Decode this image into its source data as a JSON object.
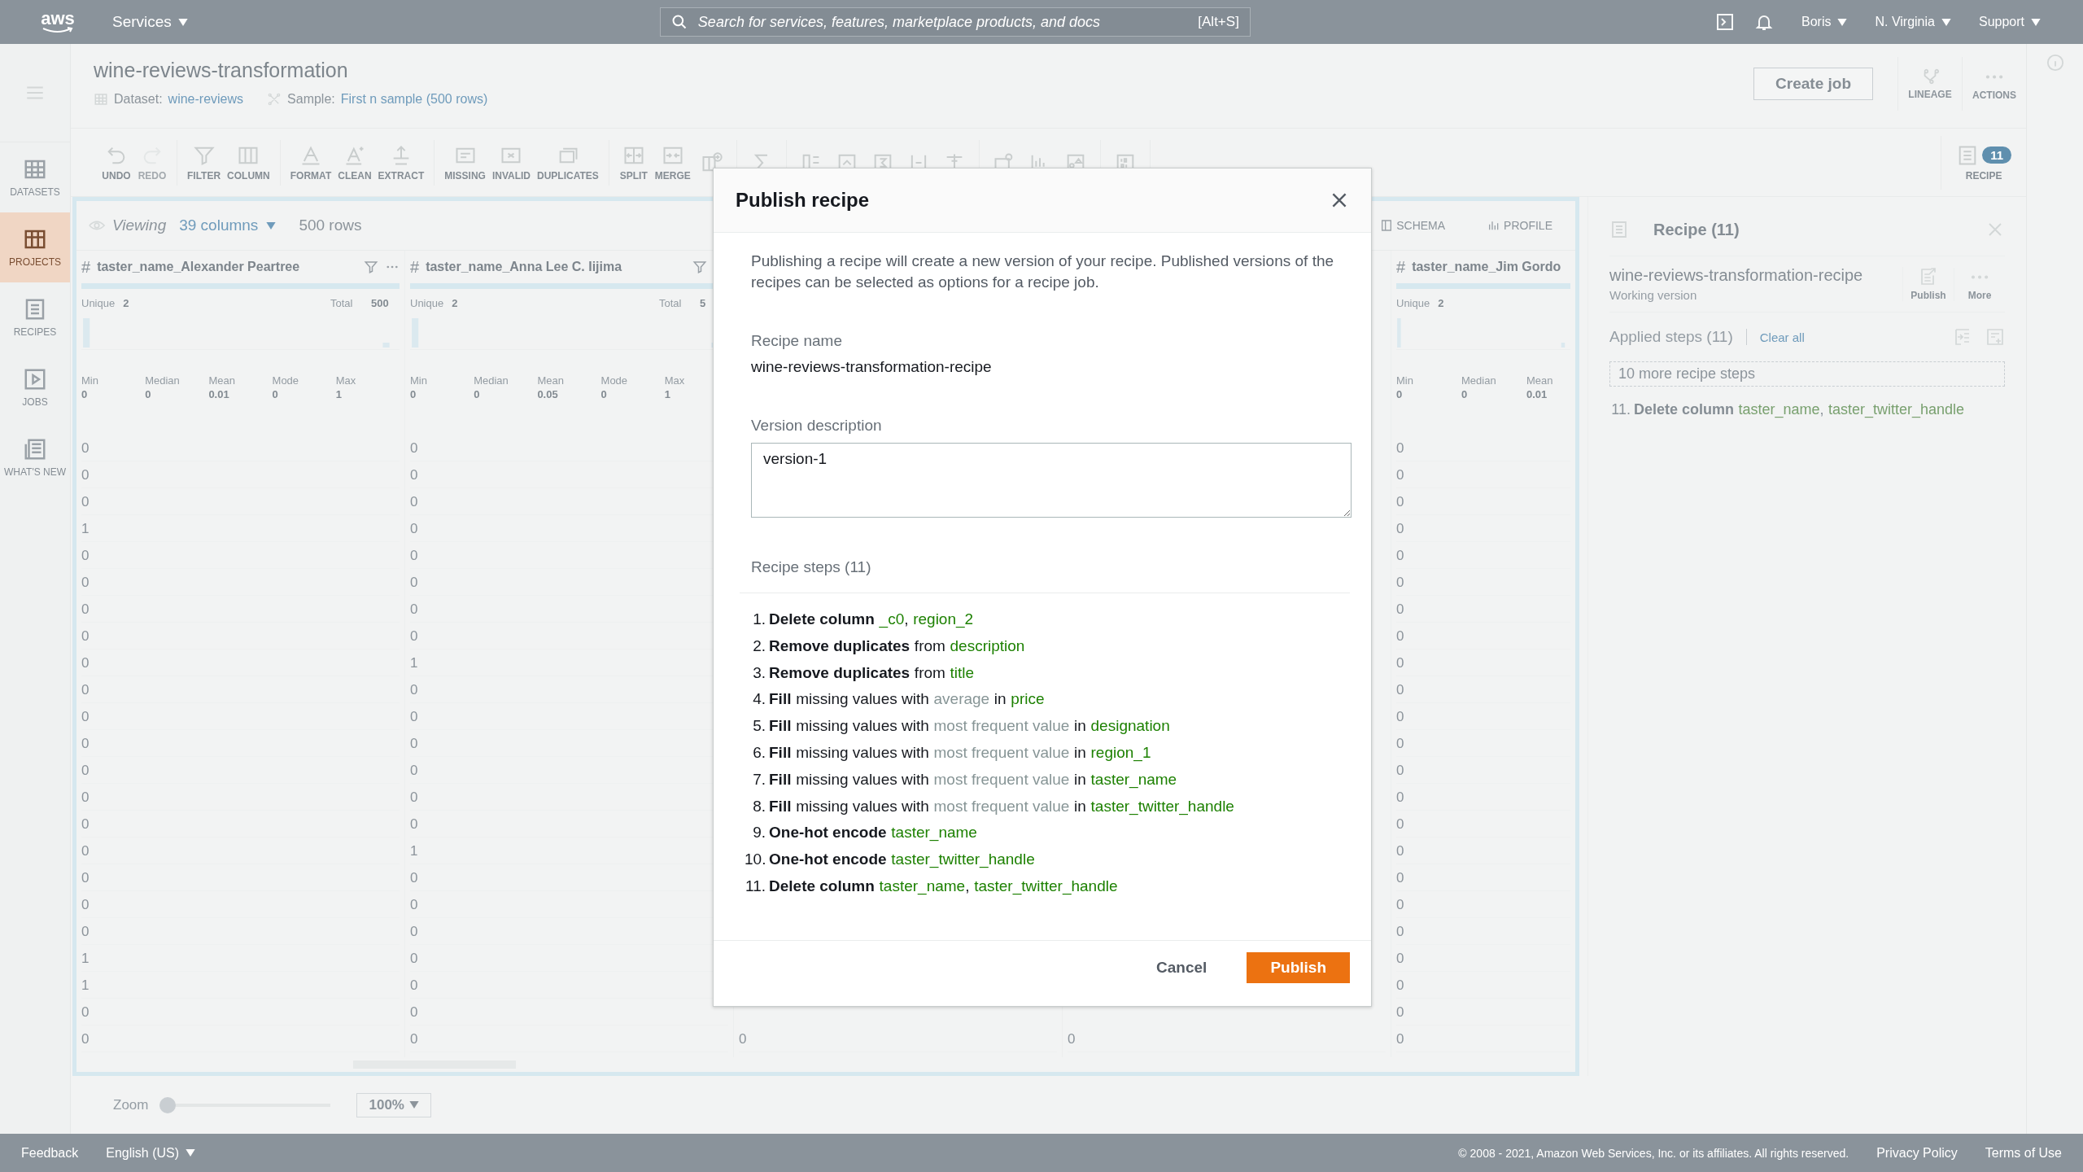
{
  "top_nav": {
    "logo": "aws",
    "services": "Services",
    "search": {
      "placeholder": "Search for services, features, marketplace products, and docs",
      "shortcut": "[Alt+S]"
    },
    "menus": [
      "Boris",
      "N. Virginia",
      "Support"
    ]
  },
  "sidebar": {
    "items": [
      {
        "label": "DATASETS",
        "selected": false
      },
      {
        "label": "PROJECTS",
        "selected": true
      },
      {
        "label": "RECIPES",
        "selected": false
      },
      {
        "label": "JOBS",
        "selected": false
      },
      {
        "label": "WHAT'S NEW",
        "selected": false
      }
    ]
  },
  "project": {
    "title": "wine-reviews-transformation",
    "dataset_label": "Dataset:",
    "dataset": "wine-reviews",
    "sample_label": "Sample:",
    "sample": "First n sample (500 rows)",
    "create_job": "Create job",
    "actions": [
      "LINEAGE",
      "ACTIONS"
    ]
  },
  "toolbar": {
    "groups": [
      [
        {
          "label": "UNDO",
          "disabled": false
        },
        {
          "label": "REDO",
          "disabled": true
        }
      ],
      [
        {
          "label": "FILTER",
          "disabled": false
        },
        {
          "label": "COLUMN",
          "disabled": false
        }
      ],
      [
        {
          "label": "FORMAT",
          "disabled": false
        },
        {
          "label": "CLEAN",
          "disabled": false
        },
        {
          "label": "EXTRACT",
          "disabled": false
        }
      ],
      [
        {
          "label": "MISSING",
          "disabled": false
        },
        {
          "label": "INVALID",
          "disabled": false
        },
        {
          "label": "DUPLICATES",
          "disabled": false
        }
      ],
      [
        {
          "label": "SPLIT",
          "disabled": false
        },
        {
          "label": "MERGE",
          "disabled": false
        },
        {
          "disabled": false
        }
      ],
      [
        {
          "disabled": false
        }
      ],
      [
        {
          "disabled": false
        },
        {
          "disabled": false
        },
        {
          "disabled": false
        },
        {
          "disabled": false
        },
        {
          "disabled": false
        }
      ],
      [
        {
          "disabled": false
        },
        {
          "disabled": false
        },
        {
          "disabled": false
        }
      ],
      [
        {
          "disabled": false
        }
      ]
    ],
    "recipe_toggle": {
      "label": "RECIPE",
      "count": "11"
    }
  },
  "grid": {
    "viewing": "Viewing",
    "columns_count": "39 columns",
    "rows_count": "500 rows",
    "views": [
      "SCHEMA",
      "PROFILE"
    ],
    "columns": [
      {
        "type_icon": "#",
        "name": "taster_name_Alexander Peartree",
        "unique_label": "Unique",
        "unique": "2",
        "total_label": "Total",
        "total": "500",
        "stats": [
          {
            "label": "Min",
            "value": "0"
          },
          {
            "label": "Median",
            "value": "0"
          },
          {
            "label": "Mean",
            "value": "0.01"
          },
          {
            "label": "Mode",
            "value": "0"
          },
          {
            "label": "Max",
            "value": "1"
          }
        ],
        "cells": [
          "0",
          "0",
          "0",
          "1",
          "0",
          "0",
          "0",
          "0",
          "0",
          "0",
          "0",
          "0",
          "0",
          "0",
          "0",
          "0",
          "0",
          "0",
          "0",
          "1",
          "1",
          "0",
          "0"
        ]
      },
      {
        "type_icon": "#",
        "name": "taster_name_Anna Lee C. Iijima",
        "unique_label": "Unique",
        "unique": "2",
        "total_label": "Total",
        "total": "5",
        "stats": [
          {
            "label": "Min",
            "value": "0"
          },
          {
            "label": "Median",
            "value": "0"
          },
          {
            "label": "Mean",
            "value": "0.05"
          },
          {
            "label": "Mode",
            "value": "0"
          },
          {
            "label": "Max",
            "value": "1"
          }
        ],
        "cells": [
          "0",
          "0",
          "0",
          "0",
          "0",
          "0",
          "0",
          "0",
          "1",
          "0",
          "0",
          "0",
          "0",
          "0",
          "0",
          "1",
          "0",
          "0",
          "0",
          "0",
          "0",
          "0",
          "0"
        ]
      },
      {
        "cells": [
          "0"
        ]
      },
      {
        "cells": [
          "0"
        ]
      },
      {
        "type_icon": "#",
        "name": "taster_name_Jim Gordo",
        "unique_label": "Unique",
        "unique": "2",
        "stats": [
          {
            "label": "Min",
            "value": "0"
          },
          {
            "label": "Median",
            "value": "0"
          },
          {
            "label": "Mean",
            "value": "0.01"
          }
        ],
        "cells": [
          "0",
          "0",
          "0",
          "0",
          "0",
          "0",
          "0",
          "0",
          "0",
          "0",
          "0",
          "0",
          "0",
          "0",
          "0",
          "0",
          "0",
          "0",
          "0",
          "0",
          "0",
          "0",
          "0"
        ]
      }
    ],
    "zoom": {
      "label": "Zoom",
      "level": 0,
      "value": "100%"
    }
  },
  "recipe_panel": {
    "title": "Recipe (11)",
    "recipe_name": "wine-reviews-transformation-recipe",
    "version": "Working version",
    "buttons": [
      "Publish",
      "More"
    ],
    "applied_steps": "Applied steps (11)",
    "clear_all": "Clear all",
    "more_steps": "10 more recipe steps",
    "last_step": {
      "number": "11.",
      "parts": [
        {
          "kind": "action",
          "text": "Delete column"
        },
        {
          "kind": "column",
          "text": "taster_name"
        },
        {
          "kind": "sep",
          "text": ","
        },
        {
          "kind": "column",
          "text": "taster_twitter_handle"
        }
      ]
    }
  },
  "footer": {
    "feedback": "Feedback",
    "language": "English (US)",
    "copyright": "© 2008 - 2021, Amazon Web Services, Inc. or its affiliates. All rights reserved.",
    "links": [
      "Privacy Policy",
      "Terms of Use"
    ]
  },
  "modal": {
    "title": "Publish recipe",
    "intro": "Publishing a recipe will create a new version of your recipe. Published versions of the recipes can be selected as options for a recipe job.",
    "recipe_name_label": "Recipe name",
    "recipe_name": "wine-reviews-transformation-recipe",
    "description_label": "Version description",
    "description": "version-1",
    "steps_heading": "Recipe steps (11)",
    "steps": [
      {
        "number": "1.",
        "parts": [
          {
            "kind": "action",
            "text": "Delete column"
          },
          {
            "kind": "column",
            "text": "_c0"
          },
          {
            "kind": "sep",
            "text": ","
          },
          {
            "kind": "column",
            "text": "region_2"
          }
        ]
      },
      {
        "number": "2.",
        "parts": [
          {
            "kind": "action",
            "text": "Remove duplicates"
          },
          {
            "kind": "text",
            "text": "from"
          },
          {
            "kind": "column",
            "text": "description"
          }
        ]
      },
      {
        "number": "3.",
        "parts": [
          {
            "kind": "action",
            "text": "Remove duplicates"
          },
          {
            "kind": "text",
            "text": "from"
          },
          {
            "kind": "column",
            "text": "title"
          }
        ]
      },
      {
        "number": "4.",
        "parts": [
          {
            "kind": "action",
            "text": "Fill"
          },
          {
            "kind": "text",
            "text": "missing values with"
          },
          {
            "kind": "param",
            "text": "average"
          },
          {
            "kind": "text",
            "text": "in"
          },
          {
            "kind": "column",
            "text": "price"
          }
        ]
      },
      {
        "number": "5.",
        "parts": [
          {
            "kind": "action",
            "text": "Fill"
          },
          {
            "kind": "text",
            "text": "missing values with"
          },
          {
            "kind": "param",
            "text": "most frequent value"
          },
          {
            "kind": "text",
            "text": "in"
          },
          {
            "kind": "column",
            "text": "designation"
          }
        ]
      },
      {
        "number": "6.",
        "parts": [
          {
            "kind": "action",
            "text": "Fill"
          },
          {
            "kind": "text",
            "text": "missing values with"
          },
          {
            "kind": "param",
            "text": "most frequent value"
          },
          {
            "kind": "text",
            "text": "in"
          },
          {
            "kind": "column",
            "text": "region_1"
          }
        ]
      },
      {
        "number": "7.",
        "parts": [
          {
            "kind": "action",
            "text": "Fill"
          },
          {
            "kind": "text",
            "text": "missing values with"
          },
          {
            "kind": "param",
            "text": "most frequent value"
          },
          {
            "kind": "text",
            "text": "in"
          },
          {
            "kind": "column",
            "text": "taster_name"
          }
        ]
      },
      {
        "number": "8.",
        "parts": [
          {
            "kind": "action",
            "text": "Fill"
          },
          {
            "kind": "text",
            "text": "missing values with"
          },
          {
            "kind": "param",
            "text": "most frequent value"
          },
          {
            "kind": "text",
            "text": "in"
          },
          {
            "kind": "column",
            "text": "taster_twitter_handle"
          }
        ]
      },
      {
        "number": "9.",
        "parts": [
          {
            "kind": "action",
            "text": "One-hot encode"
          },
          {
            "kind": "column",
            "text": "taster_name"
          }
        ]
      },
      {
        "number": "10.",
        "parts": [
          {
            "kind": "action",
            "text": "One-hot encode"
          },
          {
            "kind": "column",
            "text": "taster_twitter_handle"
          }
        ]
      },
      {
        "number": "11.",
        "parts": [
          {
            "kind": "action",
            "text": "Delete column"
          },
          {
            "kind": "column",
            "text": "taster_name"
          },
          {
            "kind": "sep",
            "text": ","
          },
          {
            "kind": "column",
            "text": "taster_twitter_handle"
          }
        ]
      }
    ],
    "buttons": [
      {
        "label": "Cancel",
        "kind": "secondary"
      },
      {
        "label": "Publish",
        "kind": "primary"
      }
    ]
  }
}
